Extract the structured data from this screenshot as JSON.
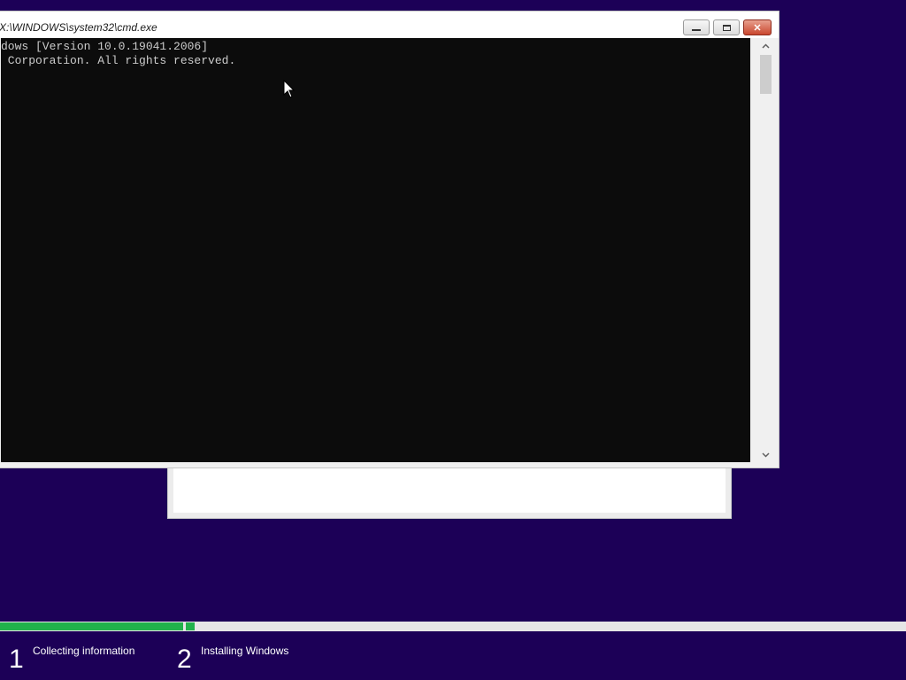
{
  "cmd_window": {
    "title": "X:\\WINDOWS\\system32\\cmd.exe",
    "lines": [
      "dows [Version 10.0.19041.2006]",
      " Corporation. All rights reserved."
    ],
    "buttons": {
      "minimize": "—",
      "maximize": "▫",
      "close": "✕"
    }
  },
  "setup_progress": {
    "steps": [
      {
        "number": "1",
        "label": "Collecting information"
      },
      {
        "number": "2",
        "label": "Installing Windows"
      }
    ],
    "colors": {
      "background": "#1c0057",
      "progress_fill": "#21b24b",
      "progress_track": "#e6e6e6"
    },
    "step1_progress": 1.0,
    "step2_progress": 0.01
  },
  "icons": {
    "scroll_up": "up-arrow",
    "scroll_down": "down-arrow",
    "cursor": "mouse-pointer"
  }
}
